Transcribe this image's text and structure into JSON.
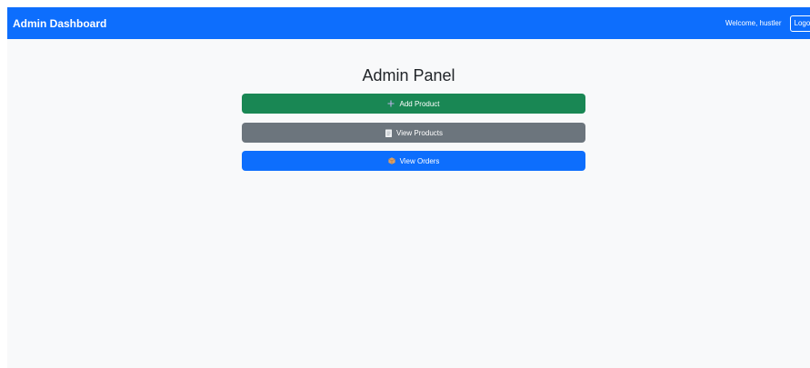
{
  "navbar": {
    "brand": "Admin Dashboard",
    "welcome": "Welcome, hustler",
    "logout_label": "Logout"
  },
  "main": {
    "title": "Admin Panel",
    "actions": [
      {
        "label": "Add Product",
        "icon": "plus-icon",
        "color": "#198754"
      },
      {
        "label": "View Products",
        "icon": "clipboard-icon",
        "color": "#6c757d"
      },
      {
        "label": "View Orders",
        "icon": "package-icon",
        "color": "#0d6efd"
      }
    ]
  },
  "colors": {
    "primary": "#0d6efd",
    "success": "#198754",
    "secondary": "#6c757d",
    "background": "#f8f9fa"
  }
}
